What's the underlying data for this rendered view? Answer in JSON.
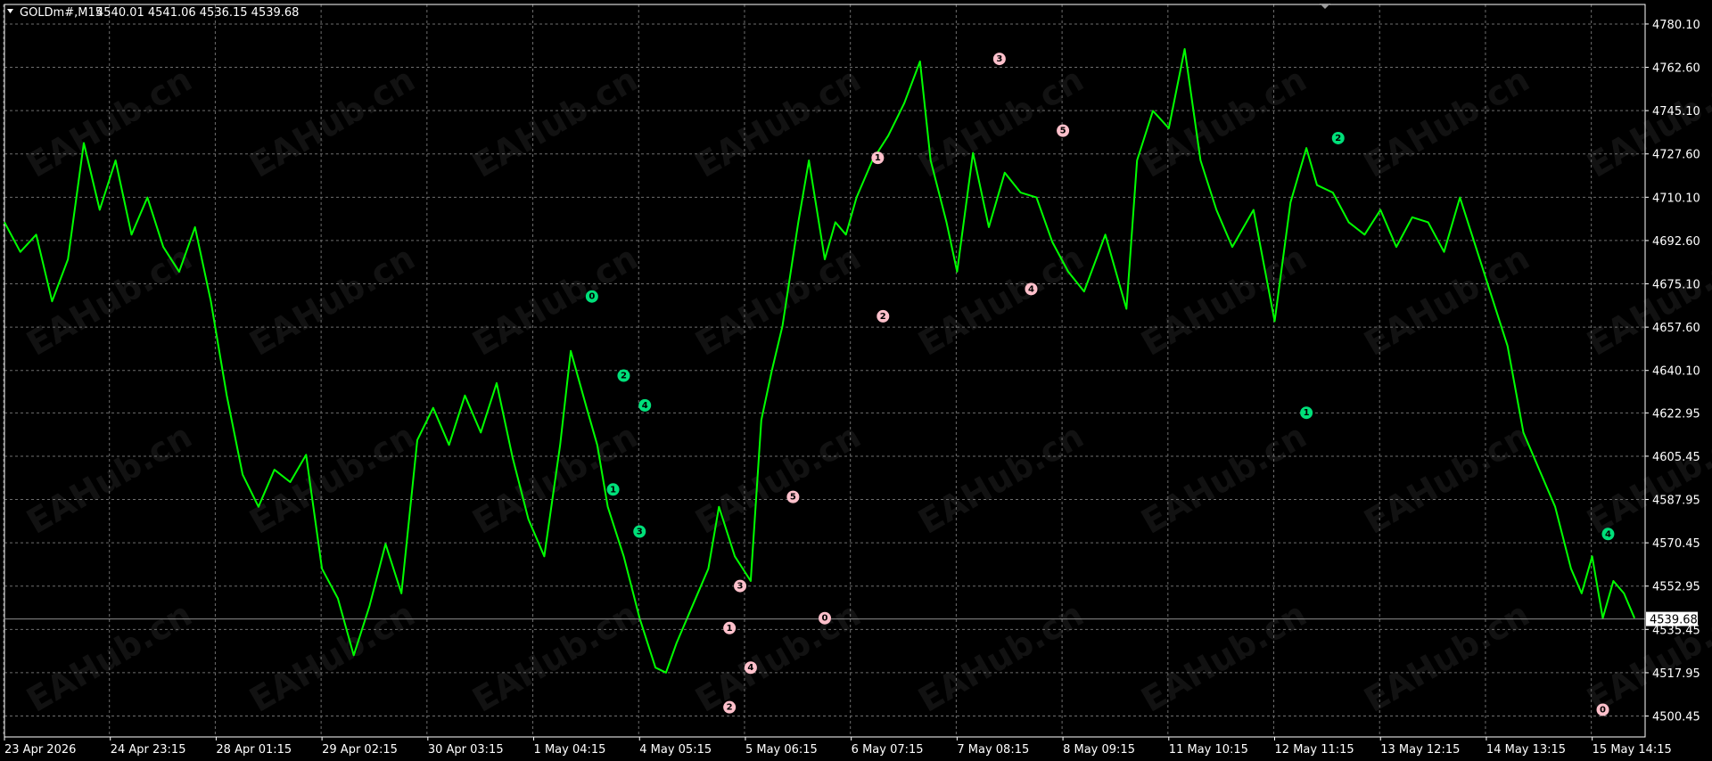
{
  "header": {
    "symbol_timeframe": "GOLDm#,M15",
    "ohlc": "4540.01 4541.06 4536.15 4539.68"
  },
  "watermark": {
    "text": "EAHub.cn"
  },
  "colors": {
    "background": "#000000",
    "grid": "#6e6e6e",
    "price_line": "#00ff00",
    "axis": "#ffffff",
    "bid_line": "#8c8c8c",
    "marker_pink": "#ffc0cb",
    "marker_green": "#00e07a"
  },
  "chart_data": {
    "type": "line",
    "title": "",
    "xlabel": "",
    "ylabel": "",
    "ylim": [
      4492,
      4788
    ],
    "y_ticks": [
      "4780.10",
      "4762.60",
      "4745.10",
      "4727.60",
      "4710.10",
      "4692.60",
      "4675.10",
      "4657.60",
      "4640.10",
      "4622.95",
      "4605.45",
      "4587.95",
      "4570.45",
      "4552.95",
      "4535.45",
      "4517.95",
      "4500.45"
    ],
    "x_ticks": [
      "23 Apr 2026",
      "24 Apr 23:15",
      "28 Apr 01:15",
      "29 Apr 02:15",
      "30 Apr 03:15",
      "1 May 04:15",
      "4 May 05:15",
      "5 May 06:15",
      "6 May 07:15",
      "7 May 08:15",
      "8 May 09:15",
      "11 May 10:15",
      "12 May 11:15",
      "13 May 12:15",
      "14 May 13:15",
      "15 May 14:15"
    ],
    "x_index_range": [
      0,
      15.5
    ],
    "current_price": "4539.68",
    "series": [
      {
        "x": [
          0,
          0.15,
          0.3,
          0.45,
          0.6,
          0.75,
          0.9,
          1.05,
          1.2,
          1.35,
          1.5,
          1.65,
          1.8,
          1.95,
          2.1,
          2.25,
          2.4,
          2.55,
          2.7,
          2.85,
          3.0,
          3.15,
          3.3,
          3.45,
          3.6,
          3.75,
          3.9,
          4.05,
          4.2,
          4.35,
          4.5,
          4.65,
          4.8,
          4.95,
          5.1,
          5.25,
          5.35,
          5.5,
          5.6,
          5.7,
          5.85,
          6.0,
          6.15,
          6.25,
          6.35,
          6.5,
          6.65,
          6.75,
          6.9,
          7.05,
          7.15,
          7.25,
          7.35,
          7.5,
          7.6,
          7.75,
          7.85,
          7.95,
          8.05,
          8.2,
          8.35,
          8.5,
          8.65,
          8.75,
          8.9,
          9.0,
          9.15,
          9.3,
          9.45,
          9.6,
          9.75,
          9.9,
          10.05,
          10.2,
          10.4,
          10.6,
          10.7,
          10.85,
          11.0,
          11.15,
          11.3,
          11.45,
          11.6,
          11.8,
          12.0,
          12.15,
          12.3,
          12.4,
          12.55,
          12.7,
          12.85,
          13.0,
          13.15,
          13.3,
          13.45,
          13.6,
          13.75,
          13.9,
          14.05,
          14.2,
          14.35,
          14.5,
          14.65,
          14.8,
          14.9,
          15.0,
          15.1,
          15.2,
          15.3,
          15.4
        ],
        "values": [
          4700,
          4688,
          4695,
          4668,
          4685,
          4732,
          4705,
          4725,
          4695,
          4710,
          4690,
          4680,
          4698,
          4668,
          4630,
          4598,
          4585,
          4600,
          4595,
          4606,
          4560,
          4548,
          4525,
          4545,
          4570,
          4550,
          4612,
          4625,
          4610,
          4630,
          4615,
          4635,
          4605,
          4580,
          4565,
          4610,
          4648,
          4625,
          4610,
          4585,
          4565,
          4540,
          4520,
          4518,
          4530,
          4545,
          4560,
          4585,
          4565,
          4555,
          4620,
          4640,
          4658,
          4700,
          4725,
          4685,
          4700,
          4695,
          4710,
          4725,
          4735,
          4748,
          4765,
          4725,
          4700,
          4680,
          4728,
          4698,
          4720,
          4712,
          4710,
          4692,
          4680,
          4672,
          4695,
          4665,
          4725,
          4745,
          4738,
          4770,
          4725,
          4705,
          4690,
          4705,
          4660,
          4708,
          4730,
          4715,
          4712,
          4700,
          4695,
          4705,
          4690,
          4702,
          4700,
          4688,
          4710,
          4690,
          4670,
          4650,
          4615,
          4600,
          4585,
          4560,
          4550,
          4565,
          4540,
          4555,
          4550,
          4540
        ]
      }
    ],
    "markers": [
      {
        "label": "0",
        "x": 5.55,
        "y": 4670,
        "color": "green"
      },
      {
        "label": "2",
        "x": 5.85,
        "y": 4638,
        "color": "green"
      },
      {
        "label": "4",
        "x": 6.05,
        "y": 4626,
        "color": "green"
      },
      {
        "label": "1",
        "x": 5.75,
        "y": 4592,
        "color": "green"
      },
      {
        "label": "3",
        "x": 6.0,
        "y": 4575,
        "color": "green"
      },
      {
        "label": "1",
        "x": 8.25,
        "y": 4726,
        "color": "pink"
      },
      {
        "label": "2",
        "x": 8.3,
        "y": 4662,
        "color": "pink"
      },
      {
        "label": "3",
        "x": 9.4,
        "y": 4766,
        "color": "pink"
      },
      {
        "label": "5",
        "x": 10.0,
        "y": 4737,
        "color": "pink"
      },
      {
        "label": "4",
        "x": 9.7,
        "y": 4673,
        "color": "pink"
      },
      {
        "label": "5",
        "x": 7.45,
        "y": 4589,
        "color": "pink"
      },
      {
        "label": "3",
        "x": 6.95,
        "y": 4553,
        "color": "pink"
      },
      {
        "label": "1",
        "x": 6.85,
        "y": 4536,
        "color": "pink"
      },
      {
        "label": "4",
        "x": 7.05,
        "y": 4520,
        "color": "pink"
      },
      {
        "label": "2",
        "x": 6.85,
        "y": 4504,
        "color": "pink"
      },
      {
        "label": "0",
        "x": 7.75,
        "y": 4540,
        "color": "pink"
      },
      {
        "label": "2",
        "x": 12.6,
        "y": 4734,
        "color": "green"
      },
      {
        "label": "1",
        "x": 12.3,
        "y": 4623,
        "color": "green"
      },
      {
        "label": "4",
        "x": 15.15,
        "y": 4574,
        "color": "green"
      },
      {
        "label": "0",
        "x": 15.1,
        "y": 4503,
        "color": "pink"
      }
    ],
    "grid": true
  }
}
